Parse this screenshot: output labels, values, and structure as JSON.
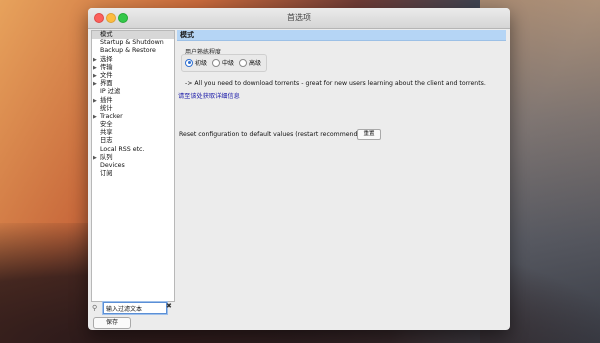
{
  "window": {
    "title": "首选项"
  },
  "sidebar": {
    "items": [
      {
        "label": "模式",
        "expandable": false,
        "selected": true
      },
      {
        "label": "Startup & Shutdown",
        "expandable": false,
        "selected": false
      },
      {
        "label": "Backup & Restore",
        "expandable": false,
        "selected": false
      },
      {
        "label": "选择",
        "expandable": true,
        "selected": false
      },
      {
        "label": "传输",
        "expandable": true,
        "selected": false
      },
      {
        "label": "文件",
        "expandable": true,
        "selected": false
      },
      {
        "label": "界面",
        "expandable": true,
        "selected": false
      },
      {
        "label": "IP 过滤",
        "expandable": false,
        "selected": false
      },
      {
        "label": "插件",
        "expandable": true,
        "selected": false
      },
      {
        "label": "统计",
        "expandable": false,
        "selected": false
      },
      {
        "label": "Tracker",
        "expandable": true,
        "selected": false
      },
      {
        "label": "安全",
        "expandable": false,
        "selected": false
      },
      {
        "label": "共享",
        "expandable": false,
        "selected": false
      },
      {
        "label": "日志",
        "expandable": false,
        "selected": false
      },
      {
        "label": "Local RSS etc.",
        "expandable": false,
        "selected": false
      },
      {
        "label": "队列",
        "expandable": true,
        "selected": false
      },
      {
        "label": "Devices",
        "expandable": false,
        "selected": false
      },
      {
        "label": "订阅",
        "expandable": false,
        "selected": false
      }
    ],
    "filter": {
      "value": "输入过滤文本"
    },
    "save_label": "保存"
  },
  "content": {
    "section_title": "模式",
    "user_level": {
      "title": "用户熟练程度",
      "options": [
        "初级",
        "中级",
        "高级"
      ],
      "selected": "初级"
    },
    "description": "-> All you need to download torrents - great for new users learning about the client and torrents.",
    "more_info_link": "请至该处获取详细信息",
    "reset": {
      "label": "Reset configuration to default values (restart recommended)",
      "button_label": "重置"
    }
  },
  "colors": {
    "selection_header": "#b5d5f5",
    "radio_accent": "#2f6fd0",
    "link": "#1a1aa8"
  }
}
